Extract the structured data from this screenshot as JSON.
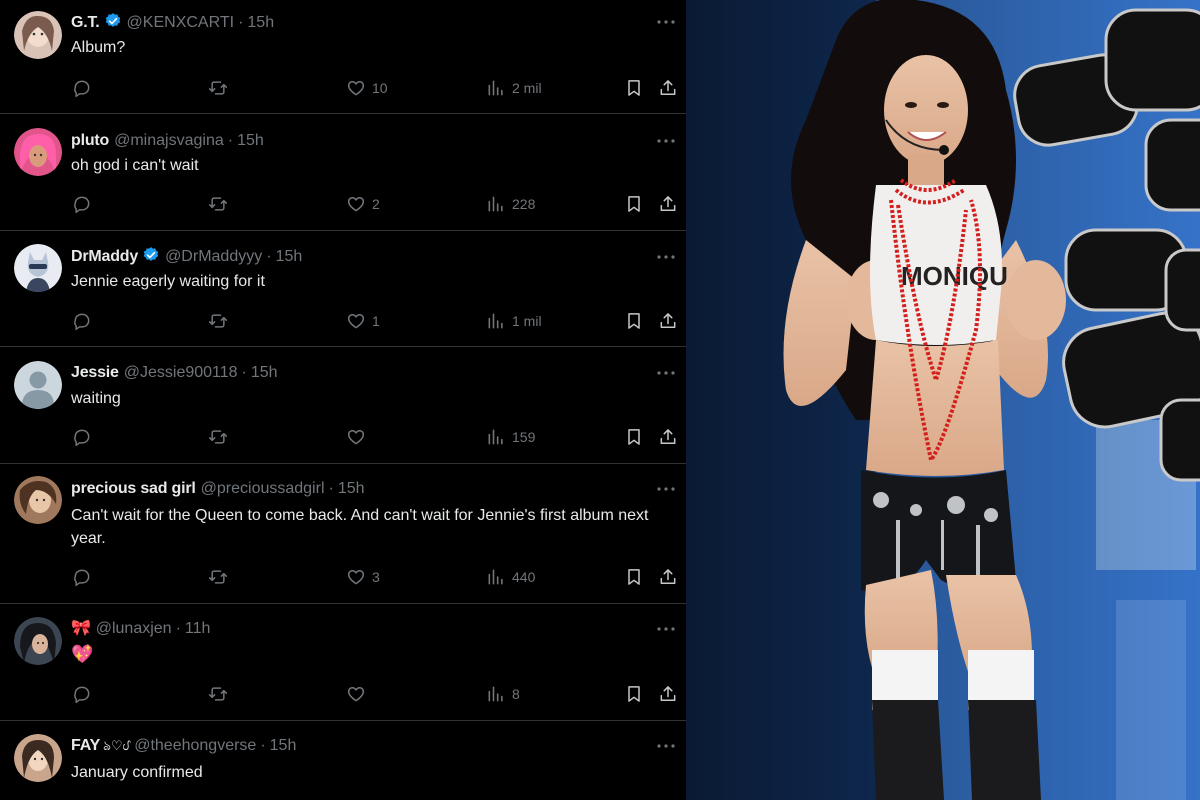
{
  "feed": {
    "tweets": [
      {
        "name": "G.T.",
        "verified": true,
        "handle": "@KENXCARTI",
        "time": "15h",
        "text": "Album?",
        "replies": "",
        "retweets": "",
        "likes": "10",
        "views": "2 mil",
        "avatar_color": "#d9c2b6"
      },
      {
        "name": "pluto",
        "verified": false,
        "handle": "@minajsvagina",
        "time": "15h",
        "text": "oh god i can't wait",
        "replies": "",
        "retweets": "",
        "likes": "2",
        "views": "228",
        "avatar_color": "#e2558a"
      },
      {
        "name": "DrMaddy",
        "verified": true,
        "handle": "@DrMaddyyy",
        "time": "15h",
        "text": "Jennie eagerly waiting for it",
        "replies": "",
        "retweets": "",
        "likes": "1",
        "views": "1 mil",
        "avatar_color": "#e8ecf2"
      },
      {
        "name": "Jessie",
        "verified": false,
        "handle": "@Jessie900118",
        "time": "15h",
        "text": "waiting",
        "replies": "",
        "retweets": "",
        "likes": "",
        "views": "159",
        "avatar_color": "#ccd6dd"
      },
      {
        "name": "precious sad girl",
        "verified": false,
        "handle": "@precioussadgirl",
        "time": "15h",
        "text": "Can't wait for the Queen to come back. And can't wait for Jennie's first album next year.",
        "replies": "",
        "retweets": "",
        "likes": "3",
        "views": "440",
        "avatar_color": "#a0785d"
      },
      {
        "name": "🎀",
        "verified": false,
        "handle": "@lunaxjen",
        "time": "11h",
        "text": "💖",
        "replies": "",
        "retweets": "",
        "likes": "",
        "views": "8",
        "avatar_color": "#3b4652"
      },
      {
        "name": "FAY",
        "name_suffix": "ঌ♡ᦔ",
        "verified": false,
        "handle": "@theehongverse",
        "time": "15h",
        "text": "January confirmed",
        "replies": "",
        "retweets": "",
        "likes": "",
        "views": "",
        "avatar_color": "#c9a58c"
      }
    ],
    "dot": "·"
  },
  "photo": {
    "subject": "performer on stage in white crop top with red bead necklaces",
    "top_text": "MONIQU",
    "background_color": "#0d2140",
    "screen_color": "#2a63b8"
  },
  "icons": {
    "reply": "reply-icon",
    "retweet": "retweet-icon",
    "like": "heart-icon",
    "views": "views-icon",
    "bookmark": "bookmark-icon",
    "share": "share-icon",
    "more": "more-icon",
    "verified": "verified-badge-icon"
  },
  "colors": {
    "background": "#000000",
    "text": "#e7e9ea",
    "muted": "#71767b",
    "divider": "#2f3336",
    "verified": "#1d9bf0"
  }
}
